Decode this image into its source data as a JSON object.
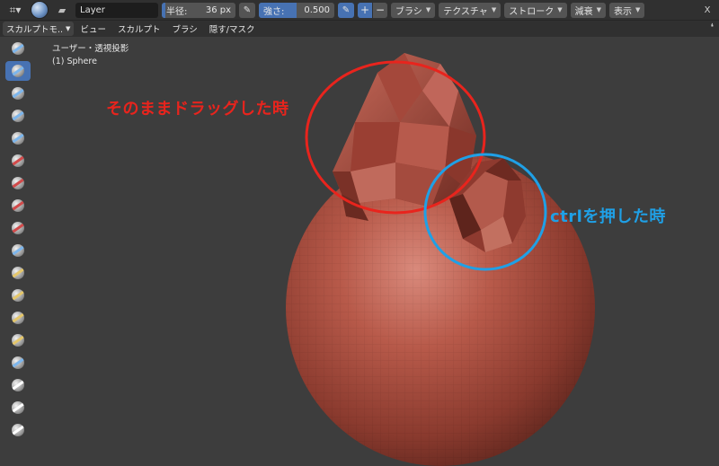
{
  "header": {
    "layer_name": "Layer",
    "radius_label": "半径:",
    "radius_value": "36 px",
    "strength_label": "強さ:",
    "strength_value": "0.500",
    "strength_fraction": 0.5,
    "plus": "+",
    "minus": "−",
    "dropdowns": [
      "ブラシ",
      "テクスチャ",
      "ストローク",
      "減衰",
      "表示"
    ],
    "close": "X"
  },
  "menubar": {
    "mode": "スカルプトモ..",
    "items": [
      "ビュー",
      "スカルプト",
      "ブラシ",
      "隠す/マスク"
    ]
  },
  "viewport": {
    "view_label": "ユーザー・透視投影",
    "object_label": "(1) Sphere",
    "annotation_red": "そのままドラッグした時",
    "annotation_blue": "ctrlを押した時",
    "colors": {
      "accent": "#4772b3",
      "annotation_red": "#e8241d",
      "annotation_blue": "#1fa0e6",
      "sphere": "#b04a3c"
    }
  },
  "tools": [
    {
      "icon": "draw-brush-icon",
      "mark": "blue"
    },
    {
      "icon": "draw-sharp-brush-icon",
      "mark": "blue",
      "active": true
    },
    {
      "icon": "clay-brush-icon",
      "mark": "blue"
    },
    {
      "icon": "clay-strips-brush-icon",
      "mark": "blue"
    },
    {
      "icon": "clay-thumb-brush-icon",
      "mark": "blue"
    },
    {
      "icon": "layer-brush-icon",
      "mark": "red"
    },
    {
      "icon": "inflate-brush-icon",
      "mark": "red"
    },
    {
      "icon": "blob-brush-icon",
      "mark": "red"
    },
    {
      "icon": "crease-brush-icon",
      "mark": "red"
    },
    {
      "icon": "smooth-brush-icon",
      "mark": "blue"
    },
    {
      "icon": "flatten-brush-icon",
      "mark": "yellow"
    },
    {
      "icon": "fill-brush-icon",
      "mark": "yellow"
    },
    {
      "icon": "scrape-brush-icon",
      "mark": "yellow"
    },
    {
      "icon": "multiplane-scrape-brush-icon",
      "mark": "yellow"
    },
    {
      "icon": "pinch-brush-icon",
      "mark": "blue"
    },
    {
      "icon": "grab-brush-icon",
      "mark": "white"
    },
    {
      "icon": "elastic-deform-brush-icon",
      "mark": "white"
    },
    {
      "icon": "snake-hook-brush-icon",
      "mark": "white"
    }
  ]
}
